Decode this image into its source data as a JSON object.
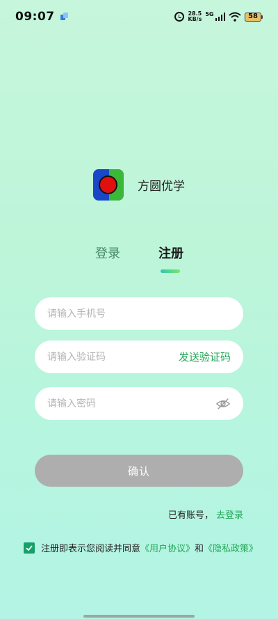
{
  "status_bar": {
    "time": "09:07",
    "net_speed_value": "28.5",
    "net_speed_unit": "KB/s",
    "network_type": "5G",
    "battery": "58"
  },
  "brand": {
    "name": "方圆优学"
  },
  "tabs": [
    {
      "label": "登录",
      "active": false
    },
    {
      "label": "注册",
      "active": true
    }
  ],
  "form": {
    "phone_placeholder": "请输入手机号",
    "code_placeholder": "请输入验证码",
    "send_code_label": "发送验证码",
    "password_placeholder": "请输入密码",
    "confirm_label": "确认"
  },
  "account": {
    "prompt": "已有账号，",
    "login_link": "去登录"
  },
  "agreement": {
    "checked": true,
    "prefix": "注册即表示您阅读并同意",
    "user_agreement": "《用户协议》",
    "and": "和",
    "privacy_policy": "《隐私政策》"
  },
  "colors": {
    "accent": "#22a857",
    "checkbox": "#17a06a",
    "button_disabled": "#aeaeae",
    "logo_blue": "#1847c8",
    "logo_green": "#3bb83a",
    "logo_red": "#e01010"
  }
}
